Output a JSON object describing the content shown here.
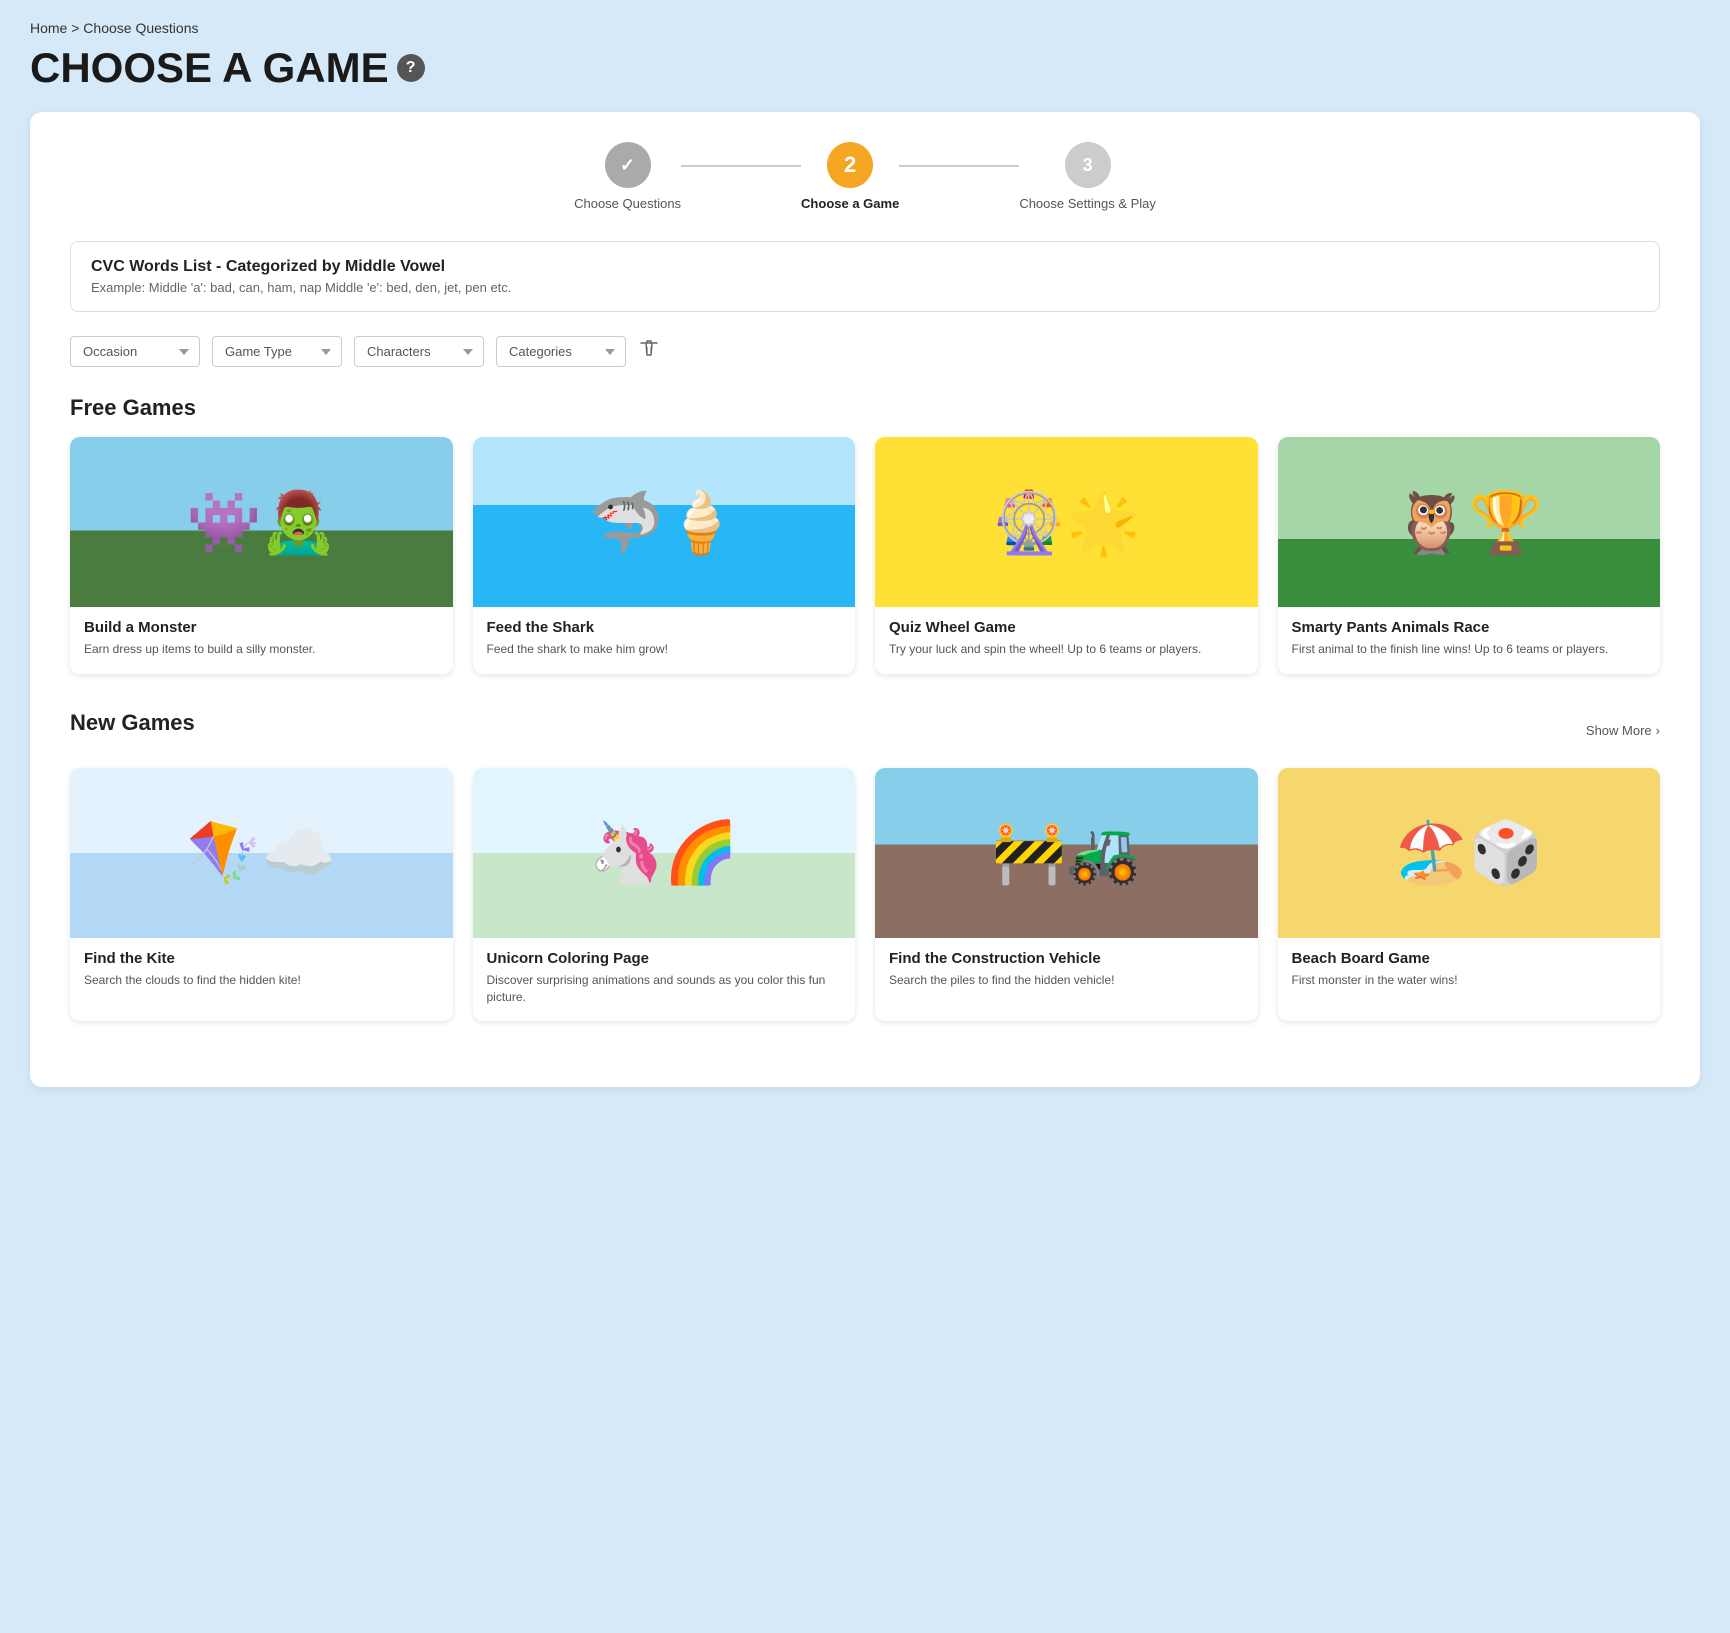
{
  "breadcrumb": "Home > Choose Questions",
  "page_title": "CHOOSE A GAME",
  "help_icon_label": "?",
  "stepper": {
    "steps": [
      {
        "id": 1,
        "label": "Choose Questions",
        "state": "done",
        "icon": "✓"
      },
      {
        "id": 2,
        "label": "Choose a Game",
        "state": "active",
        "number": "2"
      },
      {
        "id": 3,
        "label": "Choose Settings & Play",
        "state": "inactive",
        "number": "3"
      }
    ]
  },
  "wordlist": {
    "title": "CVC Words List - Categorized by Middle Vowel",
    "description": "Example: Middle 'a': bad, can, ham, nap Middle 'e': bed, den, jet, pen etc."
  },
  "filters": {
    "occasion_label": "Occasion",
    "game_type_label": "Game Type",
    "characters_label": "Characters",
    "categories_label": "Categories",
    "clear_label": "✕"
  },
  "free_games_section": "Free Games",
  "new_games_section": "New Games",
  "show_more_label": "Show More",
  "free_games": [
    {
      "name": "Build a Monster",
      "description": "Earn dress up items to build a silly monster.",
      "emoji": "👾",
      "bg": "#87ceeb",
      "accent": "#4a7c3f"
    },
    {
      "name": "Feed the Shark",
      "description": "Feed the shark to make him grow!",
      "emoji": "🦈",
      "bg": "#4fc3f7",
      "accent": "#0288d1"
    },
    {
      "name": "Quiz Wheel Game",
      "description": "Try your luck and spin the wheel! Up to 6 teams or players.",
      "emoji": "🎡",
      "bg": "#ffe135",
      "accent": "#e65100"
    },
    {
      "name": "Smarty Pants Animals Race",
      "description": "First animal to the finish line wins! Up to 6 teams or players.",
      "emoji": "🦉",
      "bg": "#90ee90",
      "accent": "#5d8a3c"
    }
  ],
  "new_games": [
    {
      "name": "Find the Kite",
      "description": "Search the clouds to find the hidden kite!",
      "emoji": "🪁",
      "bg": "#b3d9f7",
      "accent": "#7ec8e3"
    },
    {
      "name": "Unicorn Coloring Page",
      "description": "Discover surprising animations and sounds as you color this fun picture.",
      "emoji": "🦄",
      "bg": "#b3eaff",
      "accent": "#e8f5e9"
    },
    {
      "name": "Find the Construction Vehicle",
      "description": "Search the piles to find the hidden vehicle!",
      "emoji": "🚧",
      "bg": "#87ceeb",
      "accent": "#8b6914"
    },
    {
      "name": "Beach Board Game",
      "description": "First monster in the water wins!",
      "emoji": "🏖️",
      "bg": "#f5d76e",
      "accent": "#e67e22"
    }
  ]
}
